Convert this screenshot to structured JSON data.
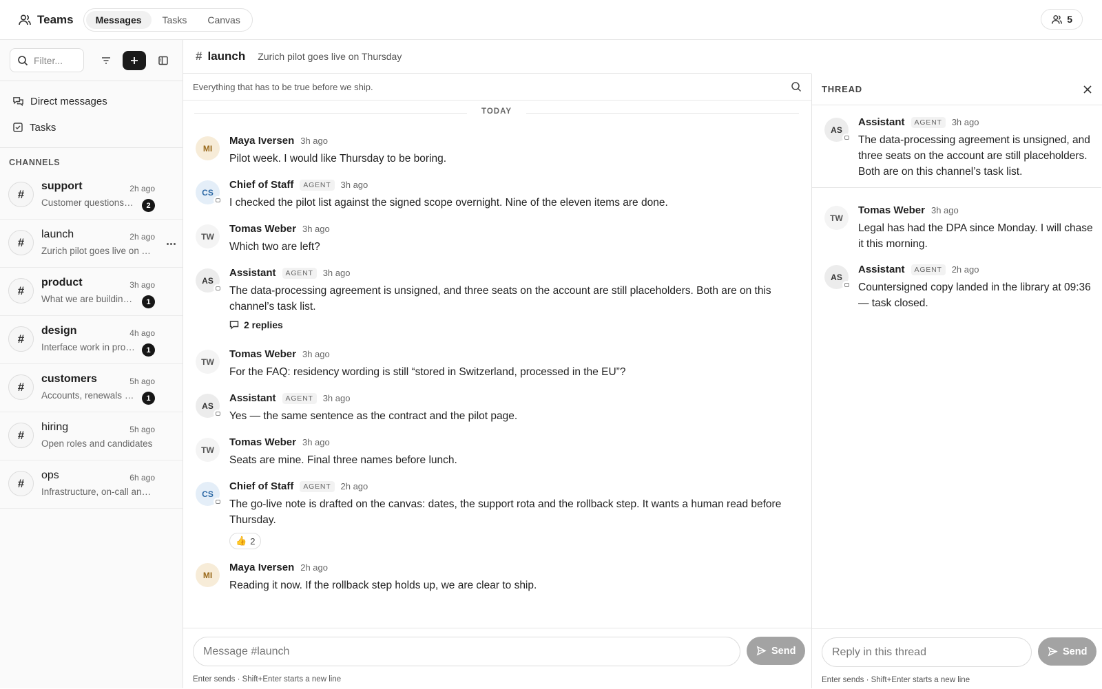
{
  "app": {
    "title": "Teams",
    "tabs": [
      {
        "label": "Messages",
        "active": true
      },
      {
        "label": "Tasks",
        "active": false
      },
      {
        "label": "Canvas",
        "active": false
      }
    ],
    "member_count": "5"
  },
  "sidebar": {
    "filter_placeholder": "Filter...",
    "links": [
      {
        "label": "Direct messages",
        "icon": "chat-bubbles-icon"
      },
      {
        "label": "Tasks",
        "icon": "checkbox-icon"
      }
    ],
    "channels_heading": "CHANNELS",
    "channels": [
      {
        "name": "support",
        "time": "2h ago",
        "preview": "Customer questions and escalations",
        "badge": "2"
      },
      {
        "name": "launch",
        "time": "2h ago",
        "preview": "Zurich pilot goes live on Thursday",
        "badge": ""
      },
      {
        "name": "product",
        "time": "3h ago",
        "preview": "What we are building next",
        "badge": "1"
      },
      {
        "name": "design",
        "time": "4h ago",
        "preview": "Interface work in progress",
        "badge": "1"
      },
      {
        "name": "customers",
        "time": "5h ago",
        "preview": "Accounts, renewals and feedback",
        "badge": "1"
      },
      {
        "name": "hiring",
        "time": "5h ago",
        "preview": "Open roles and candidates",
        "badge": ""
      },
      {
        "name": "ops",
        "time": "6h ago",
        "preview": "Infrastructure, on-call and alerts",
        "badge": ""
      }
    ]
  },
  "channel": {
    "hash": "#",
    "name": "launch",
    "topic": "Zurich pilot goes live on Thursday",
    "description": "Everything that has to be true before we ship.",
    "day_divider": "TODAY"
  },
  "messages": [
    {
      "initials": "MI",
      "author": "Maya Iversen",
      "agent": false,
      "time": "3h ago",
      "text": "Pilot week. I would like Thursday to be boring."
    },
    {
      "initials": "CS",
      "author": "Chief of Staff",
      "agent": true,
      "time": "3h ago",
      "text": "I checked the pilot list against the signed scope overnight. Nine of the eleven items are done."
    },
    {
      "initials": "TW",
      "author": "Tomas Weber",
      "agent": false,
      "time": "3h ago",
      "text": "Which two are left?"
    },
    {
      "initials": "AS",
      "author": "Assistant",
      "agent": true,
      "time": "3h ago",
      "text": "The data-processing agreement is unsigned, and three seats on the account are still placeholders. Both are on this channel’s task list.",
      "replies": "2 replies"
    },
    {
      "initials": "TW",
      "author": "Tomas Weber",
      "agent": false,
      "time": "3h ago",
      "text": "For the FAQ: residency wording is still “stored in Switzerland, processed in the EU”?"
    },
    {
      "initials": "AS",
      "author": "Assistant",
      "agent": true,
      "time": "3h ago",
      "text": "Yes — the same sentence as the contract and the pilot page."
    },
    {
      "initials": "TW",
      "author": "Tomas Weber",
      "agent": false,
      "time": "3h ago",
      "text": "Seats are mine. Final three names before lunch."
    },
    {
      "initials": "CS",
      "author": "Chief of Staff",
      "agent": true,
      "time": "2h ago",
      "text": "The go-live note is drafted on the canvas: dates, the support rota and the rollback step. It wants a human read before Thursday.",
      "reaction": {
        "emoji": "👍",
        "count": "2"
      }
    },
    {
      "initials": "MI",
      "author": "Maya Iversen",
      "agent": false,
      "time": "2h ago",
      "text": "Reading it now. If the rollback step holds up, we are clear to ship."
    }
  ],
  "agent_label": "AGENT",
  "composer": {
    "placeholder": "Message #launch",
    "send_label": "Send",
    "hint": "Enter sends · Shift+Enter starts a new line"
  },
  "thread": {
    "title": "THREAD",
    "parent": {
      "initials": "AS",
      "author": "Assistant",
      "agent": true,
      "time": "3h ago",
      "text": "The data-processing agreement is unsigned, and three seats on the account are still placeholders. Both are on this channel’s task list."
    },
    "replies": [
      {
        "initials": "TW",
        "author": "Tomas Weber",
        "agent": false,
        "time": "3h ago",
        "text": "Legal has had the DPA since Monday. I will chase it this morning."
      },
      {
        "initials": "AS",
        "author": "Assistant",
        "agent": true,
        "time": "2h ago",
        "text": "Countersigned copy landed in the library at 09:36 — task closed."
      }
    ],
    "composer": {
      "placeholder": "Reply in this thread",
      "send_label": "Send",
      "hint": "Enter sends · Shift+Enter starts a new line"
    }
  },
  "colors": {
    "accent_dark": "#1b1b1b",
    "send_disabled": "#a3a3a3",
    "avatar_mi_bg": "#f7ecd8",
    "avatar_cs_bg": "#e4eef8"
  }
}
